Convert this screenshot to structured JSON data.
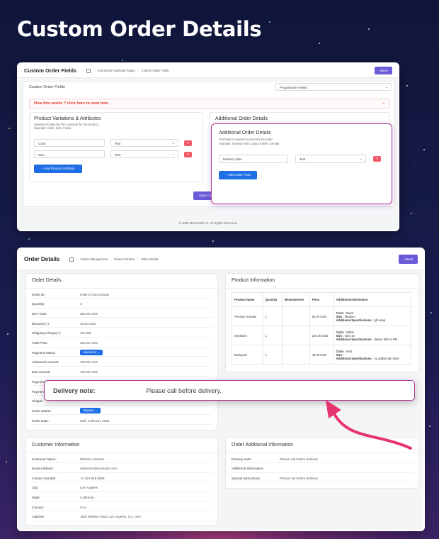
{
  "hero_title": "Custom Order Details",
  "top_panel": {
    "title": "Custom Order Fields",
    "breadcrumb": [
      "Connected Facebook Pages",
      "Custom Order Fields"
    ],
    "back_label": "«Back",
    "page_label": "Custom Order Fields",
    "page_select": "Programmer Failed",
    "how_link": "How this works ? click here to view how",
    "variations": {
      "title": "Product Variations & Attributes",
      "desc1": "Options provided by the customer for the product.",
      "desc2": "Example: Color, Size, Fabric",
      "rows": [
        {
          "name": "Color",
          "type": "Text"
        },
        {
          "name": "Size",
          "type": "Text"
        }
      ],
      "add_label": "+ Add Product Attribute"
    },
    "additional": {
      "bg_title": "Additional Order Details",
      "title": "Additional Order Details",
      "desc1": "Information required to process the order",
      "desc2": "Example: Delivery Note, Date of Birth, Gender",
      "row": {
        "name": "Delivery Note",
        "type": "Text"
      },
      "add_label": "+ Add Order Field"
    },
    "save_label": "Save Cu",
    "footer": "© 2026 MicroOrder AI. All Rights Reserved."
  },
  "bottom_panel": {
    "title": "Order Details",
    "breadcrumb": [
      "Orders Management",
      "Product Orders",
      "Order Details"
    ],
    "back_label": "«Back",
    "order_details": {
      "title": "Order Details",
      "rows": [
        {
          "k": "Order ID:",
          "v": "ORD-CY62ACWZW"
        },
        {
          "k": "Quantity:",
          "v": "3"
        },
        {
          "k": "Item Total:",
          "v": "225.00 USD"
        },
        {
          "k": "Discount (-):",
          "v": "10.00 USD"
        },
        {
          "k": "Shipping Charge(+):",
          "v": "15 USD"
        },
        {
          "k": "Total Price:",
          "v": "230.00 USD"
        },
        {
          "k": "Payment Status:",
          "v": "Advanced",
          "pill": true
        },
        {
          "k": "Advanced Amount:",
          "v": "100.00 USD"
        },
        {
          "k": "Due Amount:",
          "v": "100.00 USD"
        },
        {
          "k": "Payment",
          "v": ""
        },
        {
          "k": "Paymen",
          "v": ""
        },
        {
          "k": "Shippin",
          "v": ""
        },
        {
          "k": "Order Status:",
          "v": "Shipped",
          "pill": true
        },
        {
          "k": "Order Date:",
          "v": "04th, February 2026"
        }
      ]
    },
    "product_info": {
      "title": "Product Information",
      "headers": [
        "Product Name",
        "Quantity",
        "Measurement",
        "Price",
        "Additional Information"
      ],
      "rows": [
        {
          "name": "Premium Hoodie",
          "qty": "1",
          "meas": "-",
          "price": "60.00 USD",
          "info": [
            [
              "Color :",
              " Black"
            ],
            [
              "Size :",
              " Medium"
            ],
            [
              "Additional Specifications :",
              " gift wrap"
            ]
          ]
        },
        {
          "name": "Sneakers",
          "qty": "1",
          "meas": "-",
          "price": "120.00 USD",
          "info": [
            [
              "Color :",
              " White"
            ],
            [
              "Size :",
              " Size 10"
            ],
            [
              "Additional Specifications :",
              " deliver after 5 PM"
            ]
          ]
        },
        {
          "name": "Backpack",
          "qty": "1",
          "meas": "-",
          "price": "45.00 USD",
          "info": [
            [
              "Color :",
              " Red"
            ],
            [
              "Size :",
              " -"
            ],
            [
              "Additional Specifications :",
              " no additional notes"
            ]
          ]
        }
      ]
    },
    "customer_info": {
      "title": "Customer Information",
      "rows": [
        {
          "k": "Customer Name:",
          "v": "Michael Johnson"
        },
        {
          "k": "Email Address:",
          "v": "mjohnson@example.com"
        },
        {
          "k": "Contact Number:",
          "v": "+1 323 555 9988"
        },
        {
          "k": "City:",
          "v": "Los Angeles"
        },
        {
          "k": "State:",
          "v": "California"
        },
        {
          "k": "Country:",
          "v": "USA"
        },
        {
          "k": "Address:",
          "v": "1100 Wilshire Blvd, Los Angeles, CA, USA"
        }
      ]
    },
    "additional_info": {
      "title": "Order Additional Information",
      "rows": [
        {
          "k": "Delivery note:",
          "v": "Please call before delivery."
        },
        {
          "k": "Additional Information:",
          "v": ""
        },
        {
          "k": "Special Instructions:",
          "v": "Please call before delivery."
        }
      ]
    }
  },
  "callout": {
    "label": "Delivery note:",
    "value": "Please call before delivery."
  },
  "colors": {
    "accent": "#6a5bd8",
    "primary": "#1e6fe6",
    "danger": "#f05a66",
    "highlight": "#b03a9a",
    "arrow": "#e6356e"
  }
}
